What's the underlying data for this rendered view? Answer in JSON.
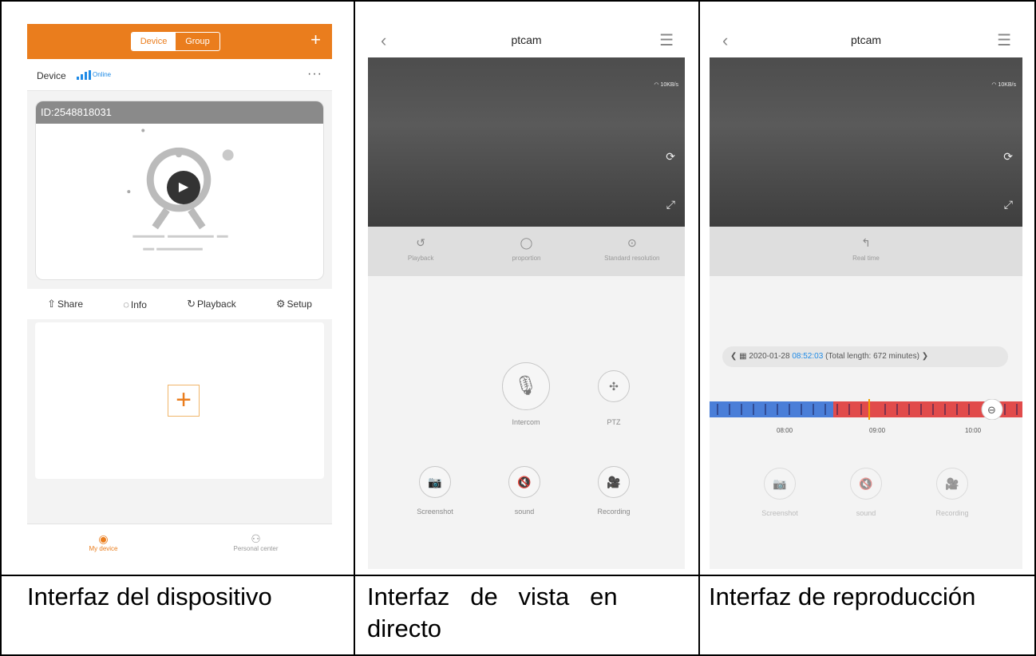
{
  "panel1": {
    "segment": {
      "device": "Device",
      "group": "Group"
    },
    "add_symbol": "+",
    "device_label": "Device",
    "status": "Online",
    "more": "···",
    "device_id": "ID:2548818031",
    "actions": [
      {
        "icon": "share-icon",
        "label": "Share"
      },
      {
        "icon": "bell-icon",
        "label": "Info"
      },
      {
        "icon": "playback-icon",
        "label": "Playback"
      },
      {
        "icon": "gear-icon",
        "label": "Setup"
      }
    ],
    "add_plus": "+",
    "tabs": [
      {
        "icon": "camera-tab-icon",
        "label": "My device"
      },
      {
        "icon": "person-icon",
        "label": "Personal center"
      }
    ]
  },
  "live": {
    "title": "ptcam",
    "speed": "10KB/s",
    "controls": [
      {
        "icon": "playback-icon",
        "label": "Playback"
      },
      {
        "icon": "proportion-icon",
        "label": "proportion"
      },
      {
        "icon": "sd-icon",
        "label": "Standard resolution"
      }
    ],
    "intercom_label": "Intercom",
    "ptz_label": "PTZ",
    "screenshot_label": "Screenshot",
    "sound_label": "sound",
    "recording_label": "Recording"
  },
  "playback": {
    "title": "ptcam",
    "speed": "10KB/s",
    "realtime_label": "Real time",
    "date": "2020-01-28",
    "time": "08:52:03",
    "total": "(Total length: 672 minutes)",
    "ticks": [
      "08:00",
      "09:00",
      "10:00"
    ],
    "screenshot_label": "Screenshot",
    "sound_label": "sound",
    "recording_label": "Recording"
  },
  "captions": {
    "device": "Interfaz del dispositivo",
    "live": "Interfaz   de   vista   en directo",
    "playback": "Interfaz de reproducción"
  },
  "colors": {
    "accent": "#ea7d1d",
    "blue": "#1e8ae6",
    "timeline_red": "#e14b4b",
    "timeline_blue": "#4a7ed8"
  }
}
